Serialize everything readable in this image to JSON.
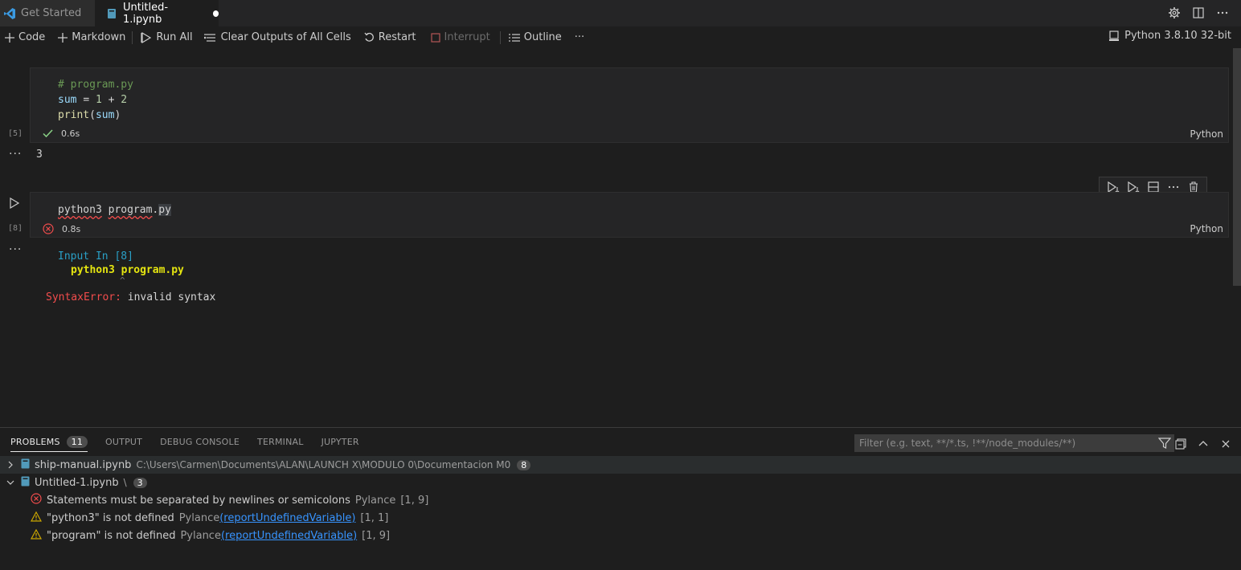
{
  "tabs": [
    {
      "label": "Get Started",
      "icon": "vscode-logo-icon",
      "active": false
    },
    {
      "label": "Untitled-1.ipynb",
      "icon": "notebook-file-icon",
      "active": true,
      "dirty": true
    }
  ],
  "toolbar": {
    "code": "Code",
    "markdown": "Markdown",
    "run_all": "Run All",
    "clear_outputs": "Clear Outputs of All Cells",
    "restart": "Restart",
    "interrupt": "Interrupt",
    "outline": "Outline",
    "more": "···",
    "kernel": "Python 3.8.10 32-bit"
  },
  "cells": [
    {
      "exec_count": "[5]",
      "lines": [
        "# program.py",
        "sum = 1 + 2",
        "print(sum)"
      ],
      "status": "success",
      "duration": "0.6s",
      "language": "Python",
      "output": "3"
    },
    {
      "exec_count": "[8]",
      "code": "python3 program.py",
      "status": "error",
      "duration": "0.8s",
      "language": "Python",
      "output": {
        "header": "Input In [8]",
        "line": "python3 program.py",
        "caret": "^",
        "error_name": "SyntaxError:",
        "error_msg": "invalid syntax"
      }
    }
  ],
  "panel": {
    "tabs": [
      "PROBLEMS",
      "OUTPUT",
      "DEBUG CONSOLE",
      "TERMINAL",
      "JUPYTER"
    ],
    "problems_count": "11",
    "filter_placeholder": "Filter (e.g. text, **/*.ts, !**/node_modules/**)",
    "groups": [
      {
        "file": "ship-manual.ipynb",
        "path": "C:\\Users\\Carmen\\Documents\\ALAN\\LAUNCH X\\MODULO 0\\Documentacion M0",
        "count": "8",
        "expanded": false
      },
      {
        "file": "Untitled-1.ipynb",
        "path": "\\",
        "count": "3",
        "expanded": true,
        "items": [
          {
            "severity": "error",
            "message": "Statements must be separated by newlines or semicolons",
            "source": "Pylance",
            "rule": "",
            "pos": "[1, 9]"
          },
          {
            "severity": "warning",
            "message": "\"python3\" is not defined",
            "source": "Pylance",
            "rule": "reportUndefinedVariable",
            "pos": "[1, 1]"
          },
          {
            "severity": "warning",
            "message": "\"program\" is not defined",
            "source": "Pylance",
            "rule": "reportUndefinedVariable",
            "pos": "[1, 9]"
          }
        ]
      }
    ]
  },
  "colors": {
    "accent": "#007acc",
    "error": "#f14c4c",
    "warning": "#cca700",
    "success": "#89d185"
  }
}
